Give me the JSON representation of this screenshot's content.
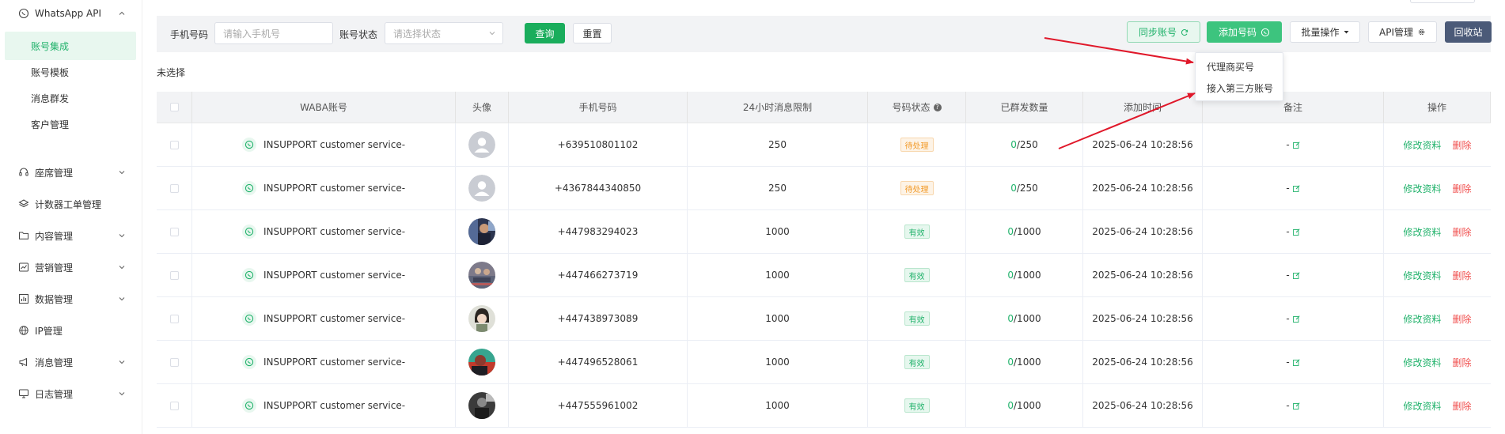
{
  "sidebar": {
    "top_item": "WhatsApp API",
    "sub_items": [
      "账号集成",
      "账号模板",
      "消息群发",
      "客户管理"
    ],
    "items": [
      {
        "label": "座席管理",
        "icon": "headset-icon",
        "expandable": true
      },
      {
        "label": "计数器工单管理",
        "icon": "layers-icon",
        "expandable": false
      },
      {
        "label": "内容管理",
        "icon": "folder-icon",
        "expandable": true
      },
      {
        "label": "营销管理",
        "icon": "chart-icon",
        "expandable": true
      },
      {
        "label": "数据管理",
        "icon": "bar-chart-icon",
        "expandable": true
      },
      {
        "label": "IP管理",
        "icon": "globe-icon",
        "expandable": false
      },
      {
        "label": "消息管理",
        "icon": "megaphone-icon",
        "expandable": true
      },
      {
        "label": "日志管理",
        "icon": "monitor-icon",
        "expandable": true
      }
    ]
  },
  "filters": {
    "phone_label": "手机号码",
    "phone_placeholder": "请输入手机号",
    "status_label": "账号状态",
    "status_placeholder": "请选择状态",
    "search_button": "查询",
    "reset_button": "重置"
  },
  "toolbar": {
    "sync_button": "同步账号",
    "add_button": "添加号码",
    "batch_button": "批量操作",
    "api_button": "API管理",
    "recycle_button": "回收站"
  },
  "dropdown": {
    "items": [
      "代理商买号",
      "接入第三方账号"
    ]
  },
  "selection_text": "未选择",
  "table": {
    "headers": [
      "WABA账号",
      "头像",
      "手机号码",
      "24小时消息限制",
      "号码状态",
      "已群发数量",
      "添加时间",
      "备注",
      "操作"
    ],
    "edit_label": "修改资料",
    "delete_label": "删除",
    "rows": [
      {
        "waba": "INSUPPORT customer service-",
        "avatar": "default",
        "phone": "+639510801102",
        "limit": "250",
        "status": "待处理",
        "status_type": "pending",
        "sent": "0",
        "sent_total": "/250",
        "time": "2025-06-24 10:28:56",
        "note": "-"
      },
      {
        "waba": "INSUPPORT customer service-",
        "avatar": "default",
        "phone": "+4367844340850",
        "limit": "250",
        "status": "待处理",
        "status_type": "pending",
        "sent": "0",
        "sent_total": "/250",
        "time": "2025-06-24 10:28:56",
        "note": "-"
      },
      {
        "waba": "INSUPPORT customer service-",
        "avatar": "photo1",
        "phone": "+447983294023",
        "limit": "1000",
        "status": "有效",
        "status_type": "valid",
        "sent": "0",
        "sent_total": "/1000",
        "time": "2025-06-24 10:28:56",
        "note": "-"
      },
      {
        "waba": "INSUPPORT customer service-",
        "avatar": "photo2",
        "phone": "+447466273719",
        "limit": "1000",
        "status": "有效",
        "status_type": "valid",
        "sent": "0",
        "sent_total": "/1000",
        "time": "2025-06-24 10:28:56",
        "note": "-"
      },
      {
        "waba": "INSUPPORT customer service-",
        "avatar": "photo3",
        "phone": "+447438973089",
        "limit": "1000",
        "status": "有效",
        "status_type": "valid",
        "sent": "0",
        "sent_total": "/1000",
        "time": "2025-06-24 10:28:56",
        "note": "-"
      },
      {
        "waba": "INSUPPORT customer service-",
        "avatar": "photo4",
        "phone": "+447496528061",
        "limit": "1000",
        "status": "有效",
        "status_type": "valid",
        "sent": "0",
        "sent_total": "/1000",
        "time": "2025-06-24 10:28:56",
        "note": "-"
      },
      {
        "waba": "INSUPPORT customer service-",
        "avatar": "photo5",
        "phone": "+447555961002",
        "limit": "1000",
        "status": "有效",
        "status_type": "valid",
        "sent": "0",
        "sent_total": "/1000",
        "time": "2025-06-24 10:28:56",
        "note": "-"
      }
    ]
  },
  "colors": {
    "accent": "#1aad5c",
    "danger": "#f0504f",
    "pending": "#f29b2a",
    "annotation_arrow": "#e0182a"
  }
}
